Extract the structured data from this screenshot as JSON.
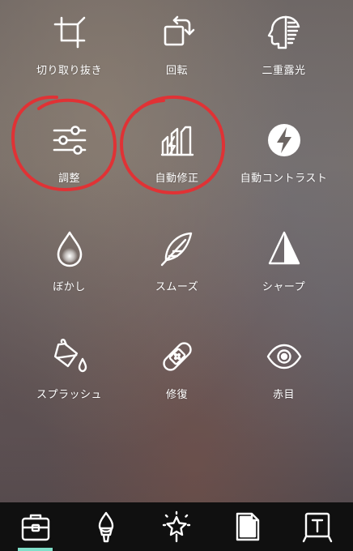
{
  "tools": [
    {
      "id": "crop",
      "label": "切り取り抜き",
      "icon": "crop-icon"
    },
    {
      "id": "rotate",
      "label": "回転",
      "icon": "rotate-icon"
    },
    {
      "id": "double-exposure",
      "label": "二重露光",
      "icon": "double-exposure-icon"
    },
    {
      "id": "adjust",
      "label": "調整",
      "icon": "sliders-icon"
    },
    {
      "id": "auto-fix",
      "label": "自動修正",
      "icon": "auto-fix-icon"
    },
    {
      "id": "auto-contrast",
      "label": "自動コントラスト",
      "icon": "lightning-icon"
    },
    {
      "id": "blur",
      "label": "ぼかし",
      "icon": "drop-icon"
    },
    {
      "id": "smooth",
      "label": "スムーズ",
      "icon": "feather-icon"
    },
    {
      "id": "sharpen",
      "label": "シャープ",
      "icon": "triangle-icon"
    },
    {
      "id": "splash",
      "label": "スプラッシュ",
      "icon": "paint-bucket-icon"
    },
    {
      "id": "repair",
      "label": "修復",
      "icon": "bandage-icon"
    },
    {
      "id": "red-eye",
      "label": "赤目",
      "icon": "eye-icon"
    }
  ],
  "tabbar": {
    "active": "tools",
    "items": [
      {
        "id": "tools",
        "icon": "toolbox-icon"
      },
      {
        "id": "brush",
        "icon": "brush-icon"
      },
      {
        "id": "effects",
        "icon": "magic-star-icon"
      },
      {
        "id": "sticker",
        "icon": "sticker-icon"
      },
      {
        "id": "text",
        "icon": "text-icon"
      }
    ]
  },
  "colors": {
    "annotation": "#e03235",
    "tab_indicator": "#7fdec8",
    "tabbar_bg": "#101010"
  }
}
